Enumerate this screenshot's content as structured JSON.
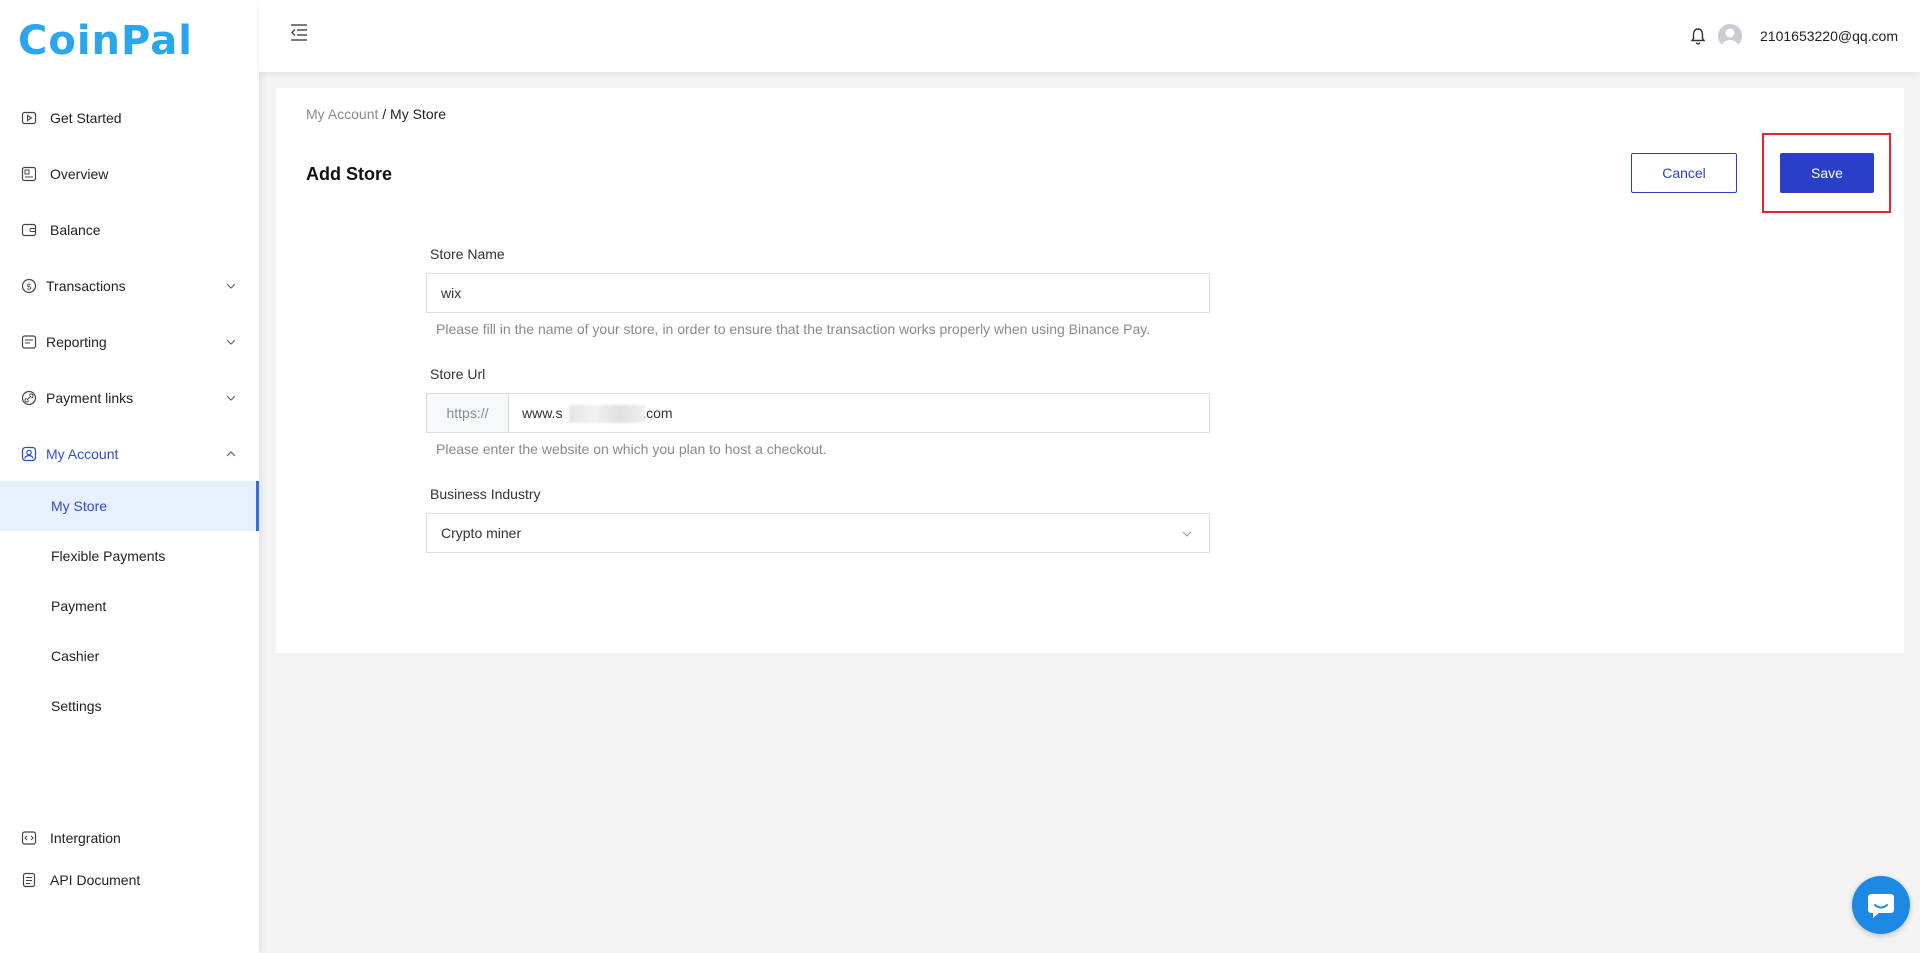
{
  "brand": {
    "logo_text": "CoinPal"
  },
  "sidebar": {
    "items": [
      {
        "label": "Get Started",
        "icon": "play-icon"
      },
      {
        "label": "Overview",
        "icon": "dashboard-icon"
      },
      {
        "label": "Balance",
        "icon": "wallet-icon"
      },
      {
        "label": "Transactions",
        "icon": "dollar-icon",
        "expandable": true
      },
      {
        "label": "Reporting",
        "icon": "report-icon",
        "expandable": true
      },
      {
        "label": "Payment links",
        "icon": "link-icon",
        "expandable": true
      },
      {
        "label": "My Account",
        "icon": "user-icon",
        "expandable": true,
        "expanded": true
      }
    ],
    "subitems": [
      {
        "label": "My Store",
        "selected": true
      },
      {
        "label": "Flexible Payments"
      },
      {
        "label": "Payment"
      },
      {
        "label": "Cashier"
      },
      {
        "label": "Settings"
      }
    ],
    "bottom_items": [
      {
        "label": "Intergration",
        "icon": "code-icon"
      },
      {
        "label": "API Document",
        "icon": "document-icon"
      }
    ]
  },
  "header": {
    "user_email": "2101653220@qq.com"
  },
  "main": {
    "breadcrumb": {
      "parent": "My Account",
      "separator": "/",
      "current": "My Store"
    },
    "title": "Add Store",
    "cancel_label": "Cancel",
    "save_label": "Save",
    "form": {
      "store_name": {
        "label": "Store Name",
        "value": "wix",
        "hint": "Please fill in the name of your store, in order to ensure that the transaction works properly when using Binance Pay."
      },
      "store_url": {
        "label": "Store Url",
        "prefix": "https://",
        "value_start": "www.s",
        "value_end": "g.com",
        "hint": "Please enter the website on which you plan to host a checkout."
      },
      "business_industry": {
        "label": "Business Industry",
        "value": "Crypto miner"
      }
    }
  },
  "colors": {
    "accent": "#2a3fc7",
    "logo": "#2aa6ef",
    "active_nav": "#2f4ec9",
    "selected_bg": "#e8f0fd",
    "highlight": "#e8232b",
    "chat": "#1e88e5"
  }
}
